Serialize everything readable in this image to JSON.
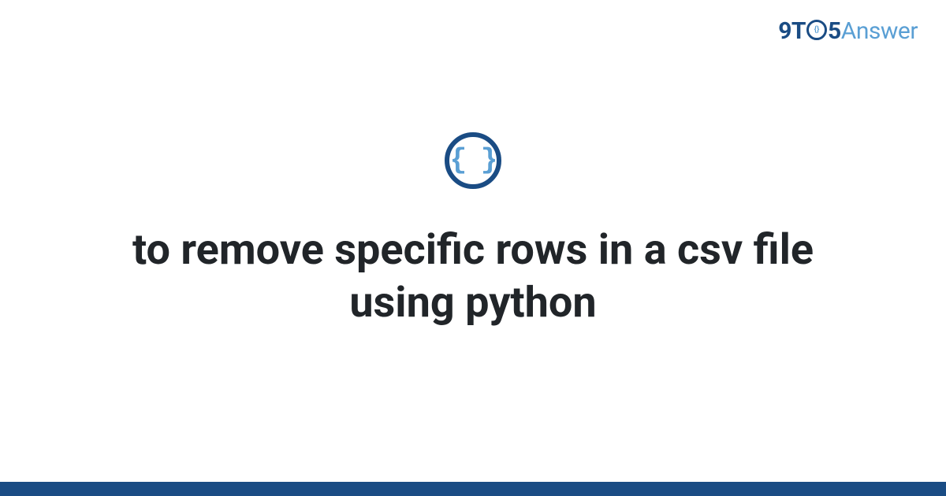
{
  "logo": {
    "part1": "9T",
    "part2": "5",
    "part3": "Answer"
  },
  "icon": {
    "braces": "{ }"
  },
  "title": "to remove specific rows in a csv file using python",
  "colors": {
    "primary": "#1a4c84",
    "secondary": "#5a9fd4",
    "text": "#212529"
  }
}
